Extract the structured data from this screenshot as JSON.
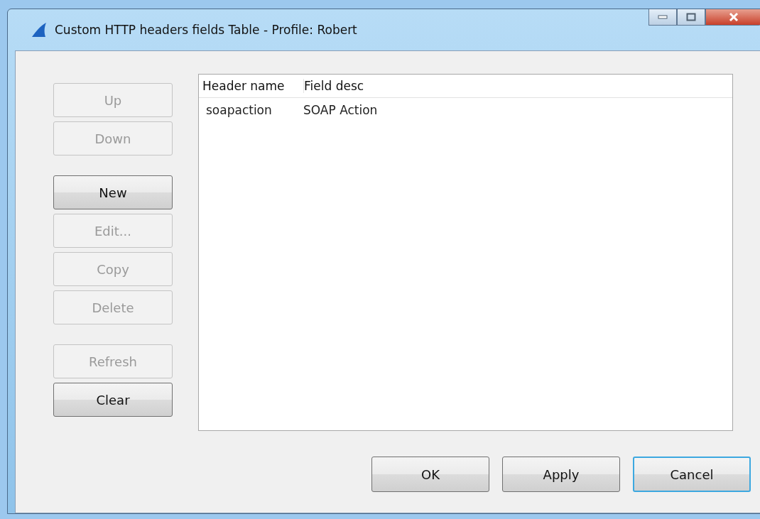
{
  "window": {
    "title": "Custom HTTP headers fields Table - Profile: Robert"
  },
  "side_button_groups": [
    [
      {
        "label": "Up",
        "disabled": true
      },
      {
        "label": "Down",
        "disabled": true
      }
    ],
    [
      {
        "label": "New",
        "disabled": false
      },
      {
        "label": "Edit...",
        "disabled": true
      },
      {
        "label": "Copy",
        "disabled": true
      },
      {
        "label": "Delete",
        "disabled": true
      }
    ],
    [
      {
        "label": "Refresh",
        "disabled": true
      },
      {
        "label": "Clear",
        "disabled": false
      }
    ]
  ],
  "table": {
    "columns": [
      "Header name",
      "Field desc"
    ],
    "rows": [
      [
        "soapaction",
        "SOAP Action"
      ]
    ]
  },
  "dialog_buttons": [
    {
      "label": "OK",
      "focused": false
    },
    {
      "label": "Apply",
      "focused": false
    },
    {
      "label": "Cancel",
      "focused": true
    }
  ]
}
